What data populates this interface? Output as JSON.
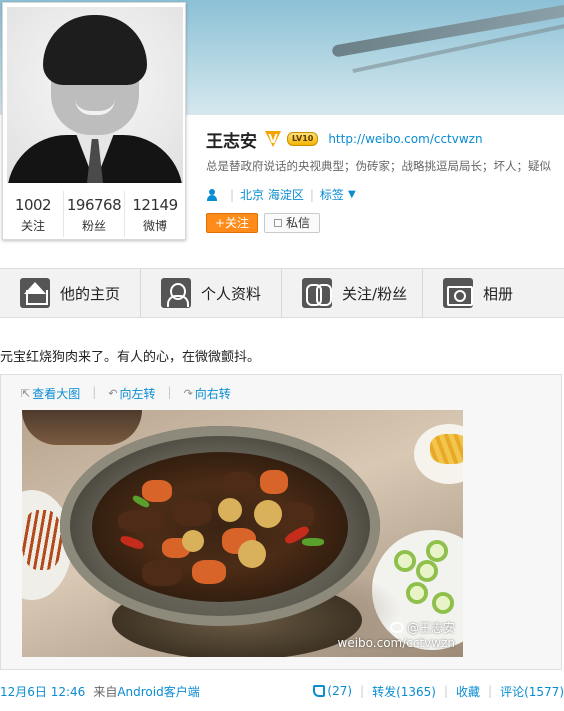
{
  "profile": {
    "name": "王志安",
    "verified_badge": "V",
    "level_badge": "LV10",
    "url": "http://weibo.com/cctvwzn",
    "bio": "总是替政府说话的央视典型；伪砖家；战略挑逗局局长；坏人；疑似",
    "location": "北京 海淀区",
    "tags_label": "标签",
    "follow_button": "+关注",
    "message_button": "私信",
    "stats": [
      {
        "value": "1002",
        "label": "关注"
      },
      {
        "value": "196768",
        "label": "粉丝"
      },
      {
        "value": "12149",
        "label": "微博"
      }
    ],
    "colors": {
      "accent": "#0a8cd2",
      "follow": "#ff8c1a",
      "badge": "#f5a300"
    }
  },
  "tabs": [
    {
      "label": "他的主页",
      "icon": "home-icon"
    },
    {
      "label": "个人资料",
      "icon": "profile-icon"
    },
    {
      "label": "关注/粉丝",
      "icon": "followers-icon"
    },
    {
      "label": "相册",
      "icon": "camera-icon"
    }
  ],
  "post": {
    "text": "元宝红烧狗肉来了。有人的心，在微微颤抖。",
    "media_actions": [
      "查看大图",
      "向左转",
      "向右转"
    ],
    "watermark_handle": "@王志安",
    "watermark_url": "weibo.com/cctvwzn",
    "time": "12月6日 12:46",
    "from_label": "来自",
    "client": "Android客户端",
    "like_count": "(27)",
    "repost": "转发(1365)",
    "favorite": "收藏",
    "comment": "评论(1577)"
  }
}
